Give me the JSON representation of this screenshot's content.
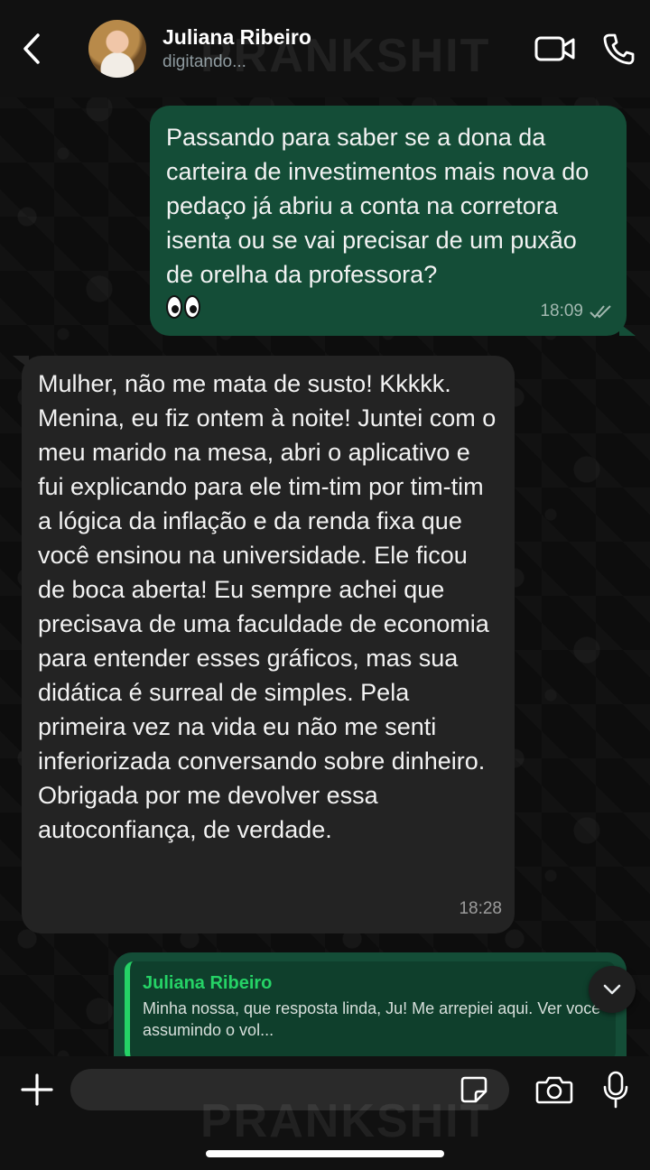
{
  "header": {
    "contact_name": "Juliana Ribeiro",
    "status": "digitando..."
  },
  "watermark": "PRANKSHIT",
  "messages": [
    {
      "direction": "outgoing",
      "text": "Passando para saber se a dona da carteira de investimentos mais nova do pedaço já abriu a conta na corretora isenta ou se vai precisar de um puxão de orelha da professora?",
      "emoji": "eyes",
      "time": "18:09",
      "status": "read"
    },
    {
      "direction": "incoming",
      "text": "Mulher, não me mata de susto! Kkkkk. Menina, eu fiz ontem à noite! Juntei com o meu marido na mesa, abri o aplicativo e fui explicando para ele tim-tim por tim-tim a lógica da inflação e da renda fixa que você ensinou na universidade. Ele ficou de boca aberta! Eu sempre achei que precisava de uma faculdade de economia para entender esses gráficos, mas sua didática é surreal de simples. Pela primeira vez na vida eu não me senti inferiorizada conversando sobre dinheiro. Obrigada por me devolver essa autoconfiança, de verdade.",
      "time": "18:28"
    }
  ],
  "reply_preview": {
    "author": "Juliana Ribeiro",
    "text": "Minha nossa, que resposta linda, Ju! Me arrepiei aqui. Ver você assumindo o vol..."
  },
  "input": {
    "placeholder": ""
  },
  "colors": {
    "outgoing_bubble": "#144d37",
    "incoming_bubble": "#232323",
    "accent_green": "#25d366",
    "header_bg": "#111111"
  }
}
